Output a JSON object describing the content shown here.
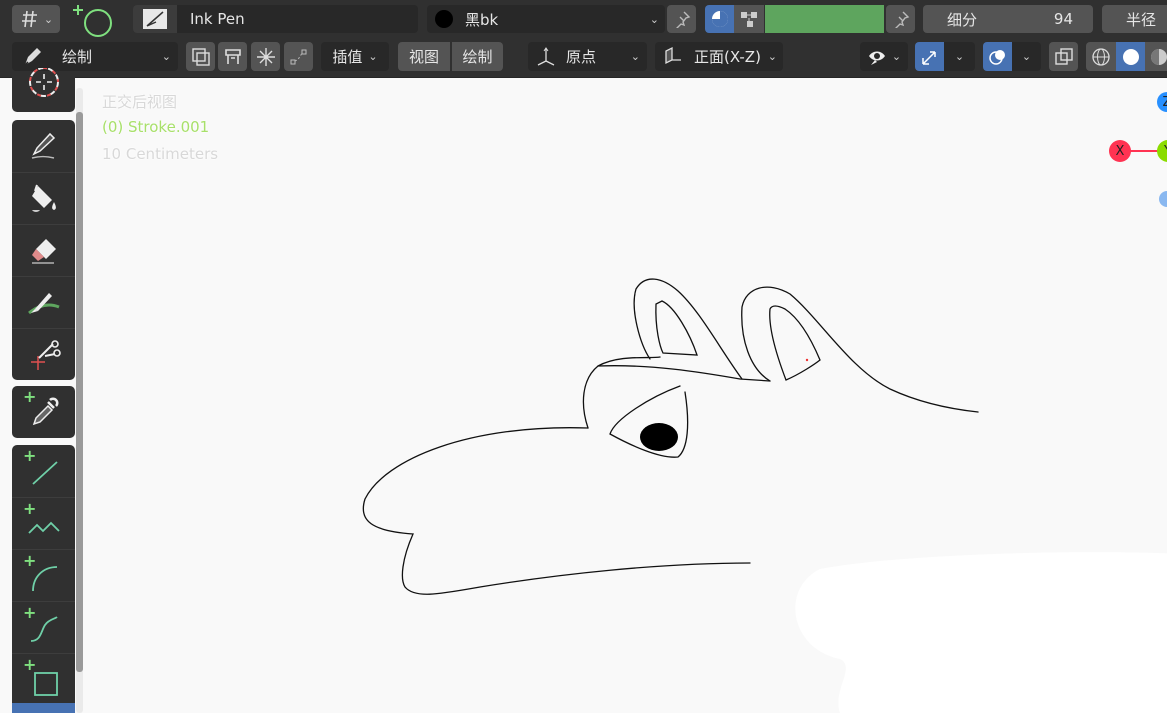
{
  "header": {
    "editor_type_icon": "grease-pencil-editor-icon",
    "add_object_icon": "add-circle-icon",
    "brush_name": "Ink Pen",
    "material_name": "黑bk",
    "color_value": "#5ea55e",
    "strength_label": "细分",
    "strength_value": "94",
    "radius_label": "半径"
  },
  "toolbar2": {
    "mode_label": "绘制",
    "interpolate_label": "插值",
    "view_label": "视图",
    "draw_label": "绘制",
    "origin_label": "原点",
    "plane_label": "正面(X-Z)"
  },
  "viewport": {
    "view_name": "正交后视图",
    "object_info": "(0) Stroke.001",
    "scale": "10 Centimeters",
    "axis_x": "X",
    "axis_y": "Y",
    "axis_z": "Z"
  },
  "tools": [
    {
      "name": "annotate-tool",
      "icon": "cursor-icon"
    },
    {
      "name": "draw-tool",
      "icon": "pencil-draw-icon"
    },
    {
      "name": "fill-tool",
      "icon": "paint-bucket-icon"
    },
    {
      "name": "erase-tool",
      "icon": "eraser-icon"
    },
    {
      "name": "tint-tool",
      "icon": "tint-brush-icon"
    },
    {
      "name": "cutter-tool",
      "icon": "scissors-icon"
    },
    {
      "name": "eyedropper-tool",
      "icon": "eyedropper-icon"
    },
    {
      "name": "line-tool",
      "icon": "line-icon"
    },
    {
      "name": "polyline-tool",
      "icon": "polyline-icon"
    },
    {
      "name": "arc-tool",
      "icon": "arc-icon"
    },
    {
      "name": "curve-tool",
      "icon": "curve-icon"
    },
    {
      "name": "box-tool",
      "icon": "box-icon"
    }
  ],
  "colors": {
    "accent_blue": "#4772b3",
    "active_green": "#5ea55e",
    "axis_x": "#ff3352",
    "axis_y": "#8bdc00",
    "axis_z": "#2890ff"
  }
}
